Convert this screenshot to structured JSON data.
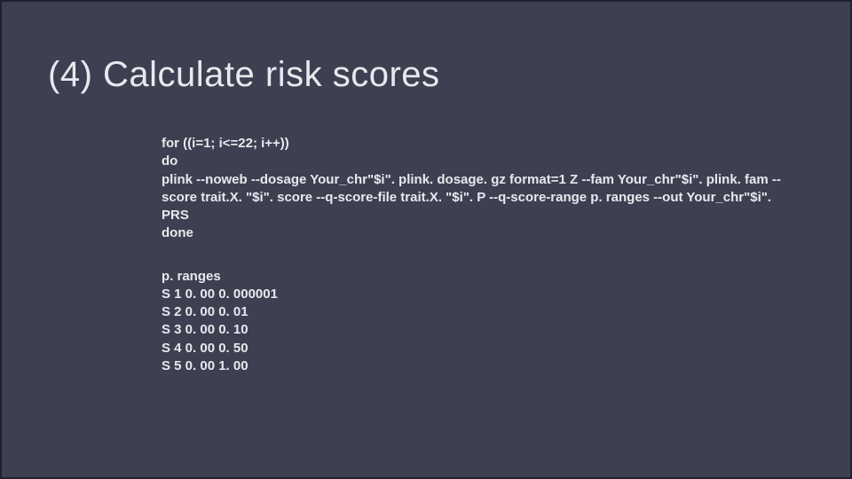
{
  "title": "(4) Calculate risk scores",
  "code": {
    "l1": "for ((i=1; i<=22; i++))",
    "l2": "do",
    "l3": "plink --noweb --dosage Your_chr\"$i\". plink. dosage. gz format=1 Z --fam Your_chr\"$i\". plink. fam --score trait.X. \"$i\". score --q-score-file trait.X. \"$i\". P --q-score-range p. ranges --out Your_chr\"$i\". PRS",
    "l4": "done"
  },
  "ranges": {
    "header": "p. ranges",
    "rows": [
      "S 1   0. 00  0. 000001",
      "S 2   0. 00  0. 01",
      "S 3   0. 00  0. 10",
      "S 4   0. 00  0. 50",
      "S 5   0. 00  1. 00"
    ]
  }
}
